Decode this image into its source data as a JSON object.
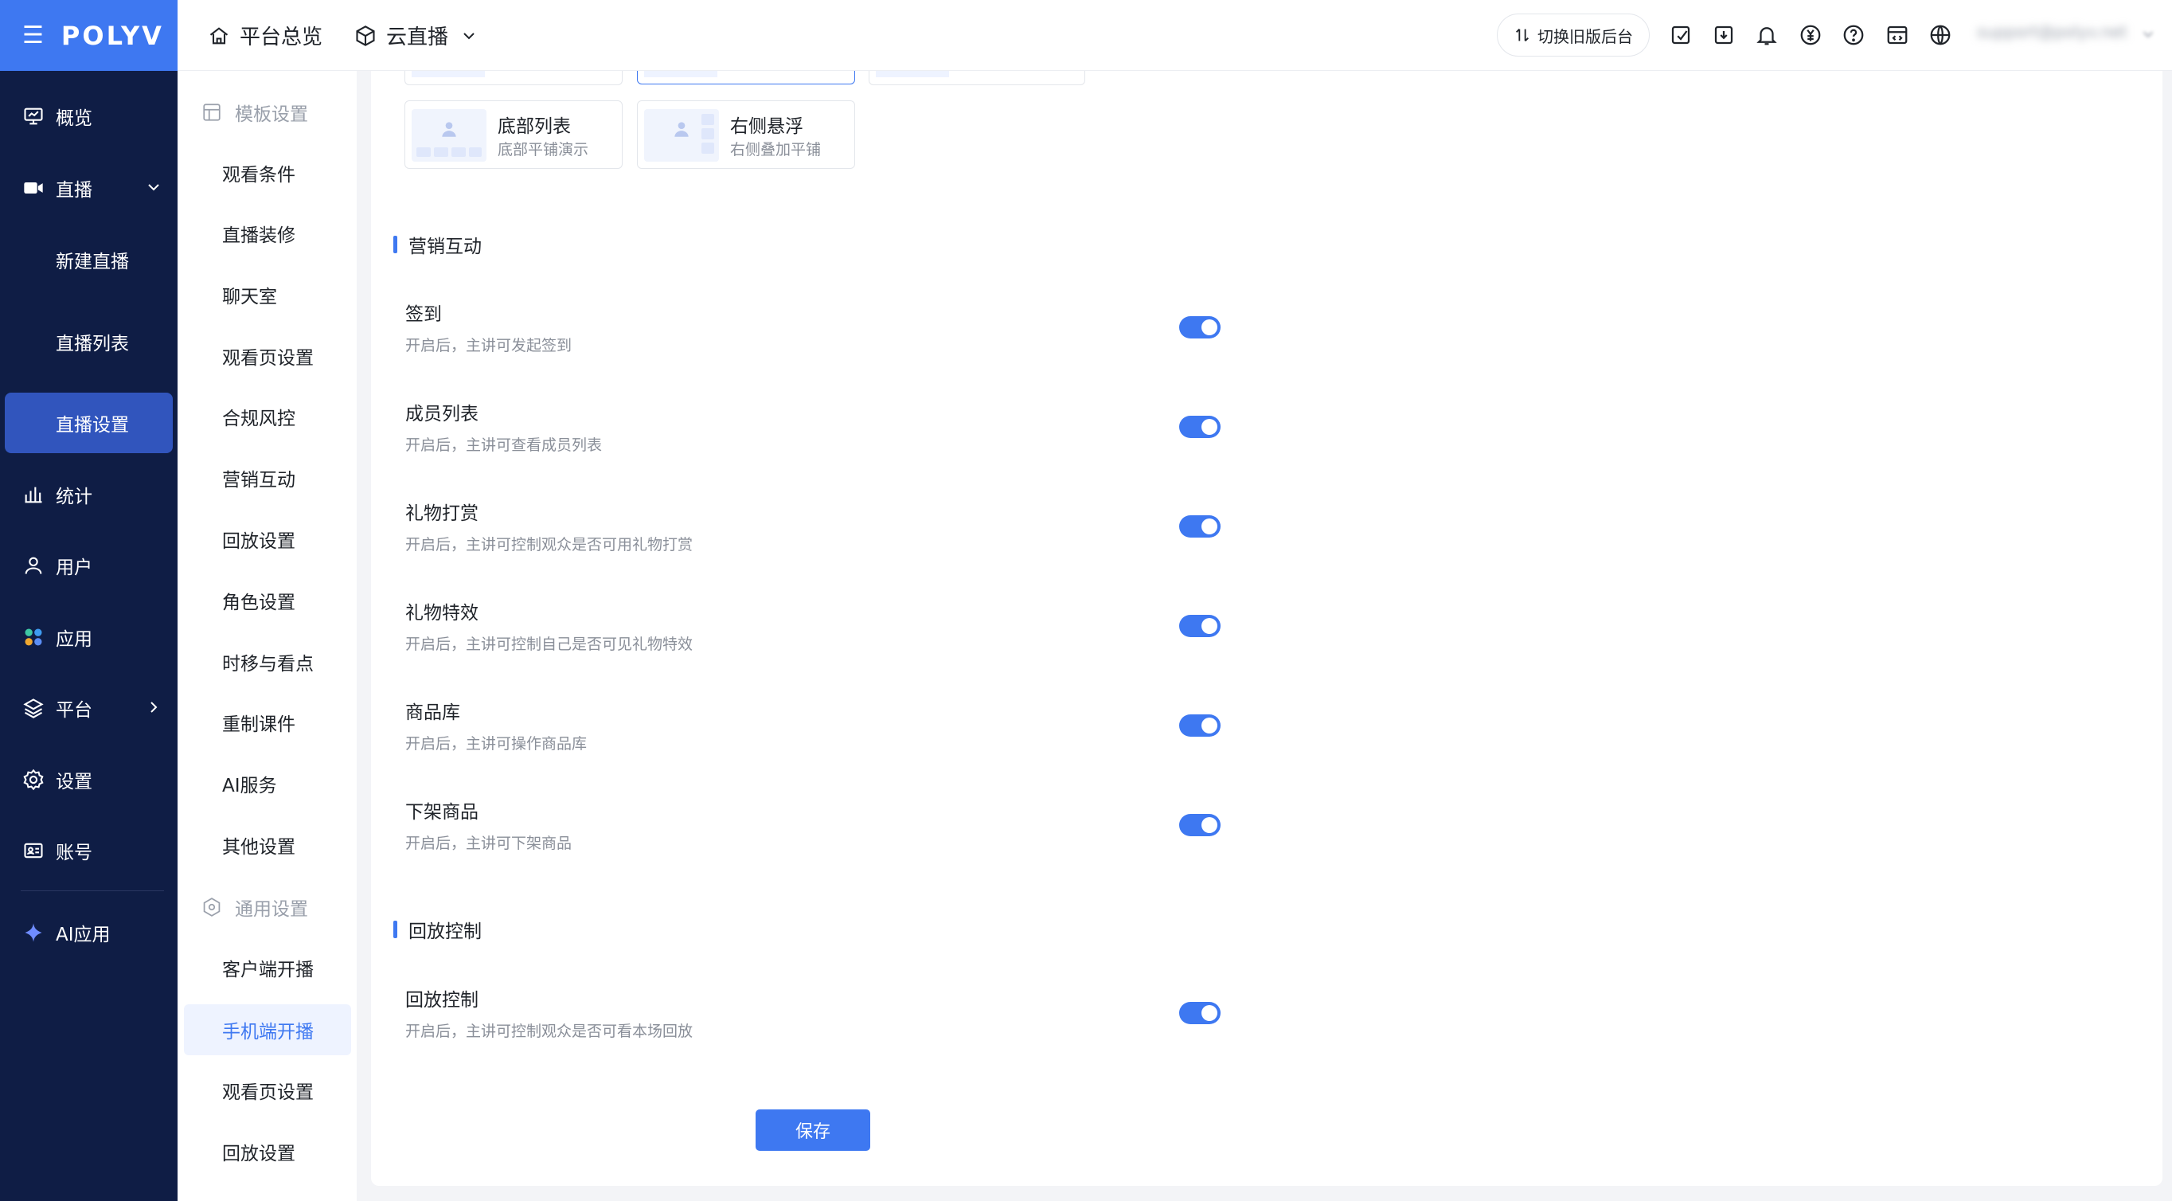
{
  "brand": {
    "logo_text": "POLYV",
    "menu_icon": "hamburger-icon"
  },
  "sidebar": {
    "items": [
      {
        "label": "概览",
        "icon": "monitor-icon"
      },
      {
        "label": "直播",
        "icon": "video-camera-icon",
        "expanded": true,
        "children": [
          "新建直播",
          "直播列表",
          "直播设置"
        ],
        "active_child": "直播设置"
      },
      {
        "label": "统计",
        "icon": "bar-chart-icon"
      },
      {
        "label": "用户",
        "icon": "user-icon"
      },
      {
        "label": "应用",
        "icon": "apps-icon"
      },
      {
        "label": "平台",
        "icon": "layers-icon"
      },
      {
        "label": "设置",
        "icon": "gear-icon"
      },
      {
        "label": "账号",
        "icon": "id-card-icon"
      },
      {
        "label": "AI应用",
        "icon": "sparkle-icon"
      }
    ]
  },
  "submenu": {
    "group1": "模板设置",
    "group1_items": [
      "观看条件",
      "直播装修",
      "聊天室",
      "观看页设置",
      "合规风控",
      "营销互动",
      "回放设置",
      "角色设置",
      "时移与看点",
      "重制课件",
      "AI服务",
      "其他设置"
    ],
    "group2": "通用设置",
    "group2_items": [
      "客户端开播",
      "手机端开播",
      "观看页设置",
      "回放设置"
    ],
    "active": "手机端开播"
  },
  "topbar": {
    "crumb_home": "平台总览",
    "crumb_product": "云直播",
    "switch_label": "切换旧版后台",
    "icons": [
      "edit-icon",
      "download-icon",
      "bell-icon",
      "yuan-icon",
      "help-icon",
      "code-icon",
      "globe-icon"
    ],
    "user_email": "support@polyv.net"
  },
  "layouts": [
    {
      "title": "底部列表",
      "desc": "底部平铺演示"
    },
    {
      "title": "右侧悬浮",
      "desc": "右侧叠加平铺"
    }
  ],
  "sections": [
    {
      "title": "营销互动",
      "settings": [
        {
          "title": "签到",
          "desc": "开启后，主讲可发起签到",
          "enabled": true
        },
        {
          "title": "成员列表",
          "desc": "开启后，主讲可查看成员列表",
          "enabled": true
        },
        {
          "title": "礼物打赏",
          "desc": "开启后，主讲可控制观众是否可用礼物打赏",
          "enabled": true
        },
        {
          "title": "礼物特效",
          "desc": "开启后，主讲可控制自己是否可见礼物特效",
          "enabled": true
        },
        {
          "title": "商品库",
          "desc": "开启后，主讲可操作商品库",
          "enabled": true
        },
        {
          "title": "下架商品",
          "desc": "开启后，主讲可下架商品",
          "enabled": true
        }
      ]
    },
    {
      "title": "回放控制",
      "settings": [
        {
          "title": "回放控制",
          "desc": "开启后，主讲可控制观众是否可看本场回放",
          "enabled": true
        }
      ]
    }
  ],
  "save_label": "保存",
  "colors": {
    "primary": "#3e78f1",
    "sidebar_bg": "#0f1d45",
    "sidebar_active": "#3155bd"
  }
}
